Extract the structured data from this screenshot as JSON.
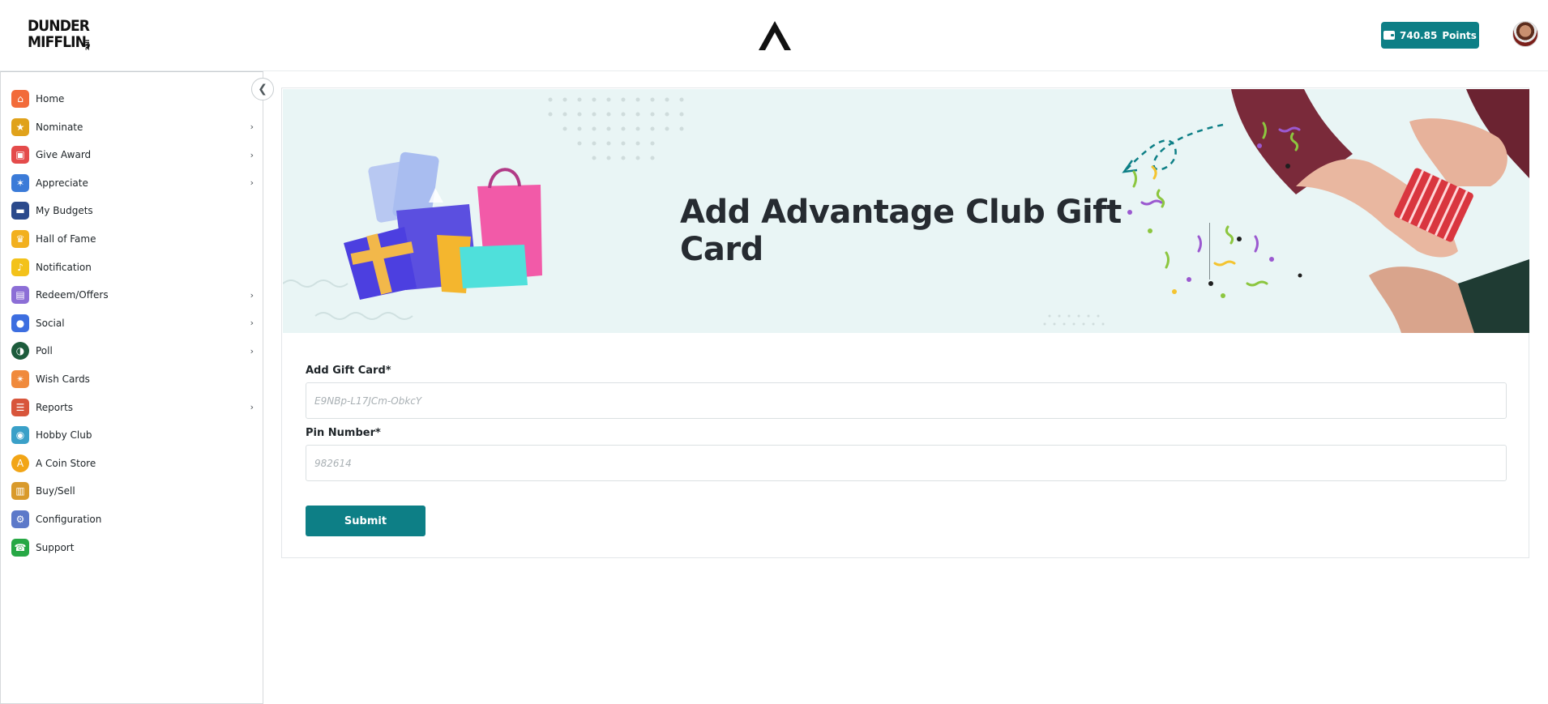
{
  "header": {
    "brand_line1": "DUNDER",
    "brand_line2": "MIFFLIN,",
    "brand_suffix": "INC",
    "points_value": "740.85",
    "points_label": "Points"
  },
  "sidebar": {
    "items": [
      {
        "label": "Home",
        "icon": "home-icon",
        "color": "#f26b3a",
        "has_submenu": false
      },
      {
        "label": "Nominate",
        "icon": "trophy-icon",
        "color": "#e0a21b",
        "has_submenu": true
      },
      {
        "label": "Give Award",
        "icon": "gift-icon",
        "color": "#e44b4b",
        "has_submenu": true
      },
      {
        "label": "Appreciate",
        "icon": "medal-icon",
        "color": "#3b7bd8",
        "has_submenu": true
      },
      {
        "label": "My Budgets",
        "icon": "wallet-icon",
        "color": "#2b4a8c",
        "has_submenu": false
      },
      {
        "label": "Hall of Fame",
        "icon": "crown-icon",
        "color": "#f2b01e",
        "has_submenu": false
      },
      {
        "label": "Notification",
        "icon": "bell-icon",
        "color": "#f3c21a",
        "has_submenu": false
      },
      {
        "label": "Redeem/Offers",
        "icon": "coupon-icon",
        "color": "#8c6ed6",
        "has_submenu": true
      },
      {
        "label": "Social",
        "icon": "thumbs-up-icon",
        "color": "#3d6ee0",
        "has_submenu": true
      },
      {
        "label": "Poll",
        "icon": "poll-icon",
        "color": "#1d5c3c",
        "has_submenu": true
      },
      {
        "label": "Wish Cards",
        "icon": "party-popper-icon",
        "color": "#f08a3c",
        "has_submenu": false
      },
      {
        "label": "Reports",
        "icon": "clipboard-icon",
        "color": "#d8553b",
        "has_submenu": true
      },
      {
        "label": "Hobby Club",
        "icon": "palette-icon",
        "color": "#3aa0c8",
        "has_submenu": false
      },
      {
        "label": "A Coin Store",
        "icon": "coin-icon",
        "color": "#f2a516",
        "has_submenu": false
      },
      {
        "label": "Buy/Sell",
        "icon": "shopping-bags-icon",
        "color": "#d99a2b",
        "has_submenu": false
      },
      {
        "label": "Configuration",
        "icon": "config-icon",
        "color": "#5c79c9",
        "has_submenu": false
      },
      {
        "label": "Support",
        "icon": "phone-icon",
        "color": "#27a845",
        "has_submenu": false
      }
    ]
  },
  "banner": {
    "title": "Add Advantage Club Gift Card"
  },
  "form": {
    "gift_card_label": "Add Gift Card*",
    "gift_card_placeholder": "E9NBp-L17JCm-ObkcY",
    "pin_label": "Pin Number*",
    "pin_placeholder": "982614",
    "submit_label": "Submit"
  }
}
